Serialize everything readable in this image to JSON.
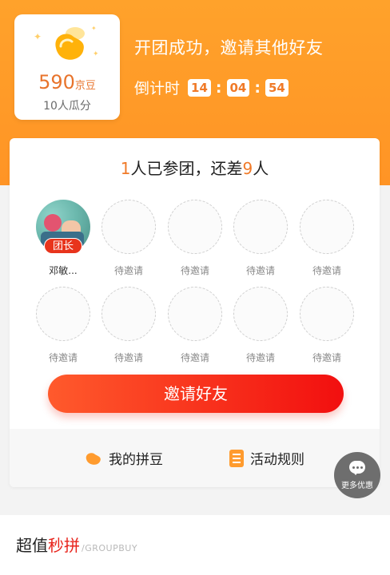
{
  "reward": {
    "amount": "590",
    "unit": "京豆",
    "split_text": "10人瓜分"
  },
  "headline": "开团成功，邀请其他好友",
  "countdown": {
    "label": "倒计时",
    "hours": "14",
    "minutes": "04",
    "seconds": "54"
  },
  "group": {
    "joined_count": "1",
    "joined_text": "人已参团，还差",
    "remaining_count": "9",
    "remaining_text": "人",
    "leader": {
      "badge": "团长",
      "name": "邓敏..."
    },
    "empty_slot_label": "待邀请",
    "empty_slots": [
      {
        "label": "待邀请"
      },
      {
        "label": "待邀请"
      },
      {
        "label": "待邀请"
      },
      {
        "label": "待邀请"
      },
      {
        "label": "待邀请"
      },
      {
        "label": "待邀请"
      },
      {
        "label": "待邀请"
      },
      {
        "label": "待邀请"
      },
      {
        "label": "待邀请"
      }
    ]
  },
  "invite_button": "邀请好友",
  "footer": {
    "my_beans": "我的拼豆",
    "rules": "活动规则"
  },
  "more_deals": "更多优惠",
  "section": {
    "title_part1": "超值",
    "title_part2": "秒拼",
    "title_english": "/GROUPBUY"
  },
  "colors": {
    "hero": "#ffa22b",
    "accent_orange": "#f07a28",
    "button_red": "#f20f0f",
    "badge_red": "#e8341c"
  }
}
